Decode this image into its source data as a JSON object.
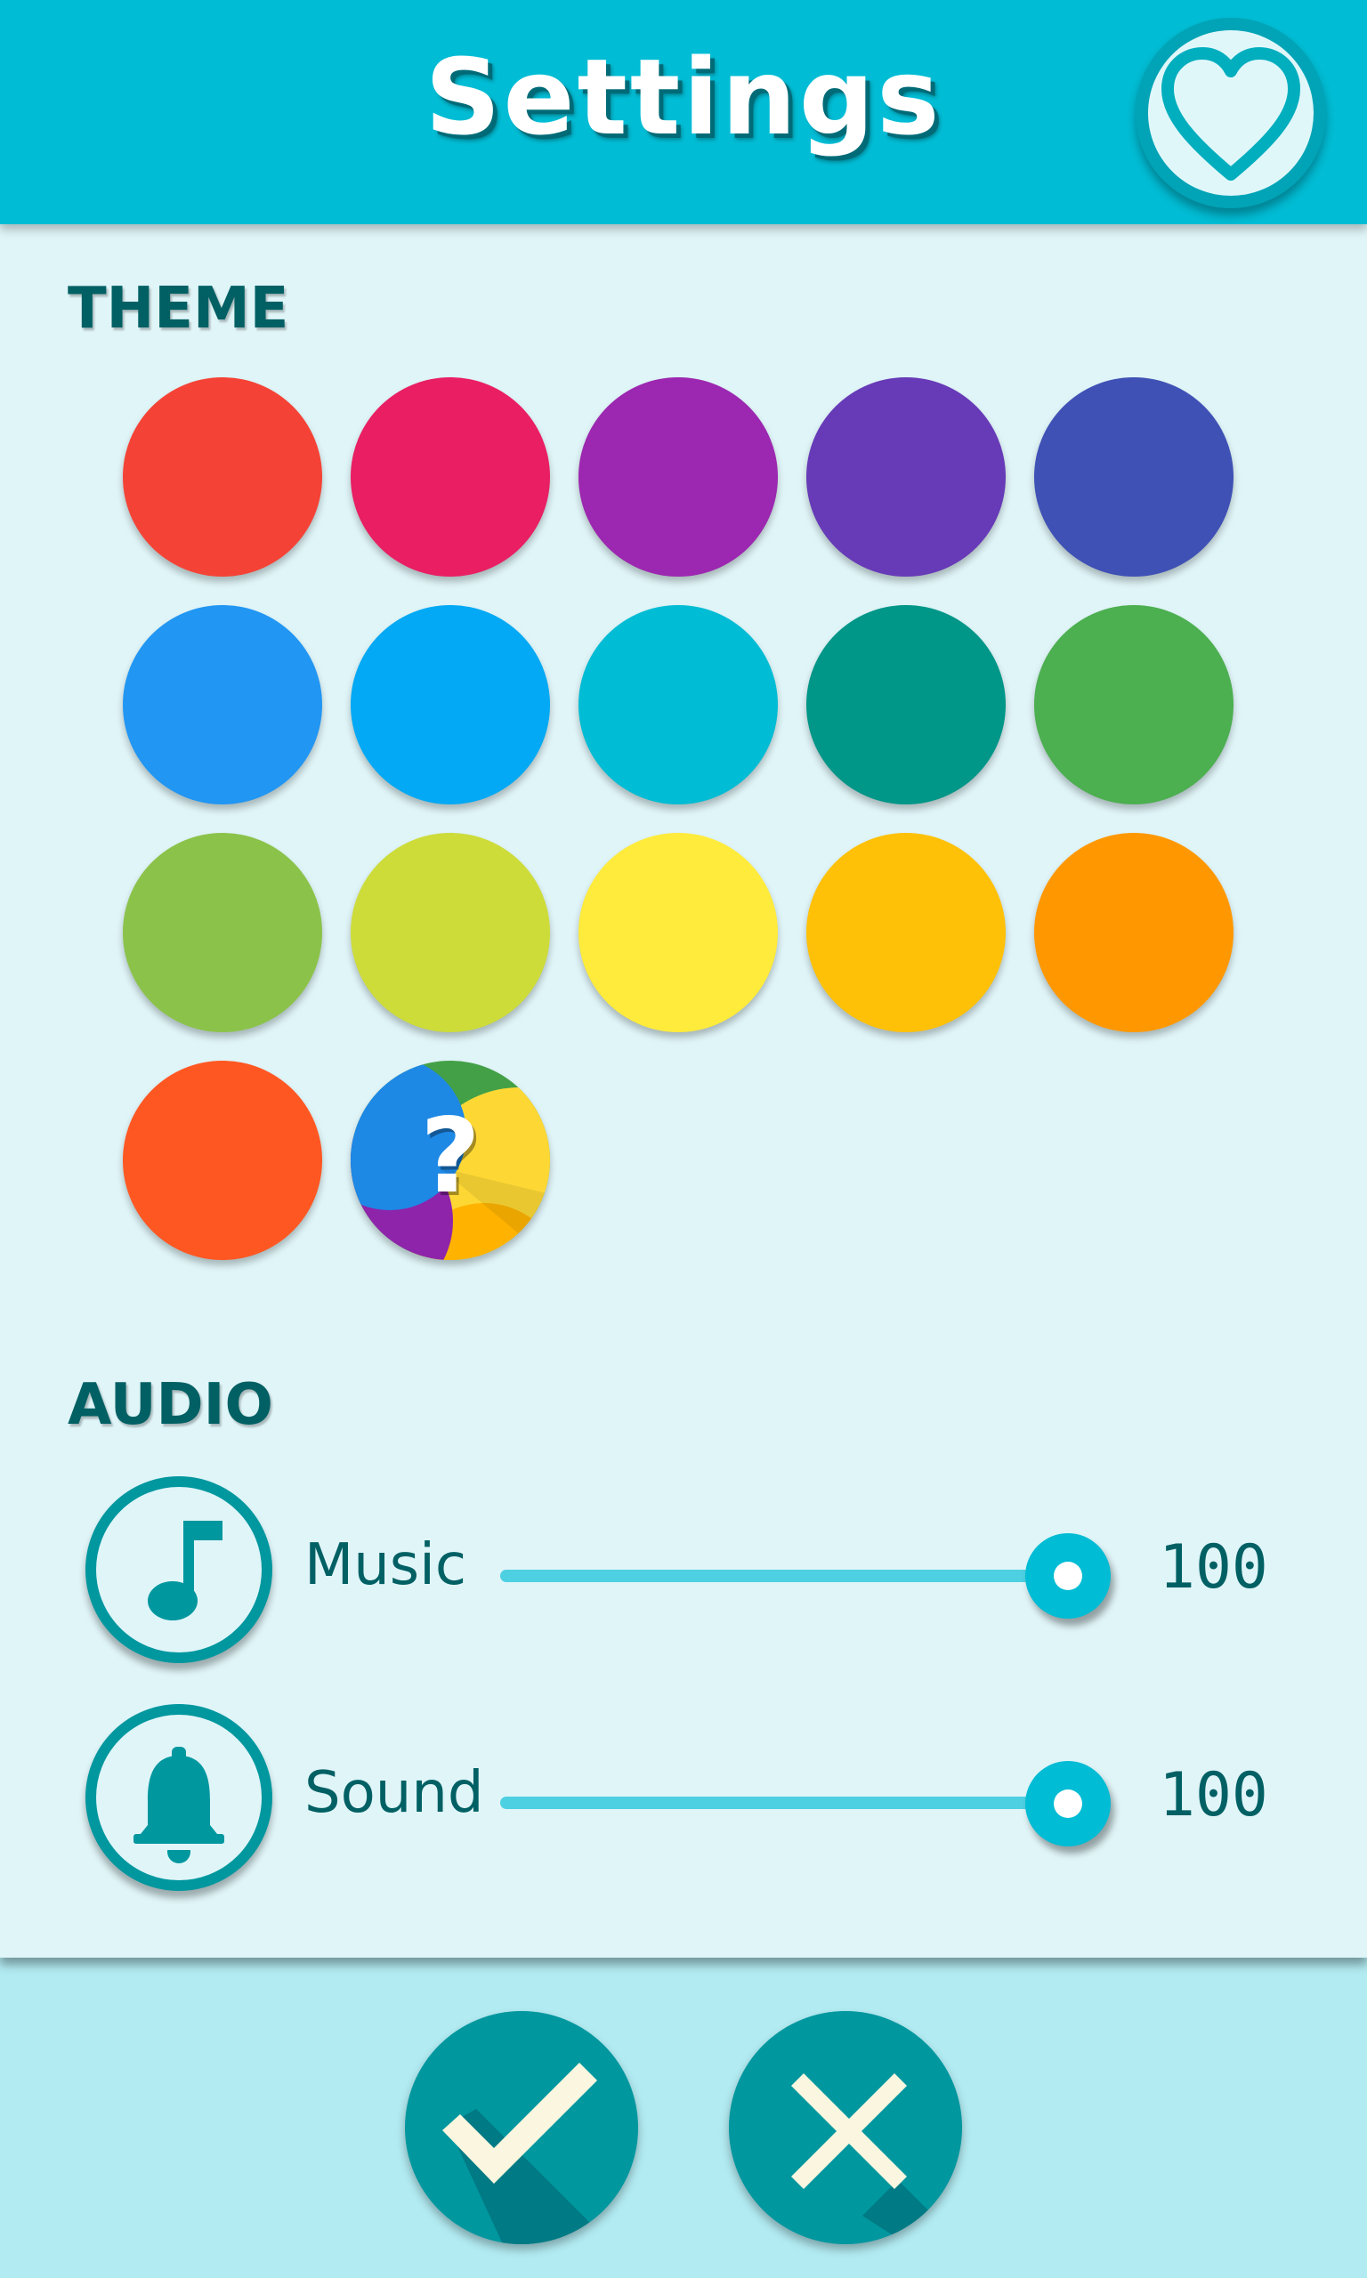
{
  "header": {
    "title": "Settings",
    "favorite_icon": "heart-outline-icon"
  },
  "theme": {
    "label": "THEME",
    "swatches": [
      {
        "name": "red",
        "color": "#f44336"
      },
      {
        "name": "pink",
        "color": "#e91e63"
      },
      {
        "name": "purple",
        "color": "#9c27b0"
      },
      {
        "name": "deep-purple",
        "color": "#673ab7"
      },
      {
        "name": "indigo",
        "color": "#3f51b5"
      },
      {
        "name": "blue",
        "color": "#2196f3"
      },
      {
        "name": "light-blue",
        "color": "#03a9f4"
      },
      {
        "name": "cyan",
        "color": "#00bcd4"
      },
      {
        "name": "teal",
        "color": "#009688"
      },
      {
        "name": "green",
        "color": "#4caf50"
      },
      {
        "name": "light-green",
        "color": "#8bc34a"
      },
      {
        "name": "lime",
        "color": "#cddc39"
      },
      {
        "name": "yellow",
        "color": "#ffeb3b"
      },
      {
        "name": "amber",
        "color": "#ffc107"
      },
      {
        "name": "orange",
        "color": "#ff9800"
      },
      {
        "name": "deep-orange",
        "color": "#ff5722"
      }
    ],
    "random_swatch": {
      "label": "?",
      "colors": [
        "#43a047",
        "#fdd835",
        "#ffb300",
        "#8e24aa",
        "#1e88e5"
      ]
    }
  },
  "audio": {
    "label": "AUDIO",
    "music": {
      "label": "Music",
      "value": "100",
      "level": 100,
      "icon": "music-note-icon"
    },
    "sound": {
      "label": "Sound",
      "value": "100",
      "level": 100,
      "icon": "bell-icon"
    }
  },
  "actions": {
    "confirm_icon": "checkmark-icon",
    "cancel_icon": "close-icon"
  },
  "colors": {
    "header": "#00bcd4",
    "panel": "#e0f5f8",
    "background": "#b2ebf2",
    "accent_dark": "#00979f",
    "text_dark": "#006064",
    "glyph": "#fbf6df"
  }
}
